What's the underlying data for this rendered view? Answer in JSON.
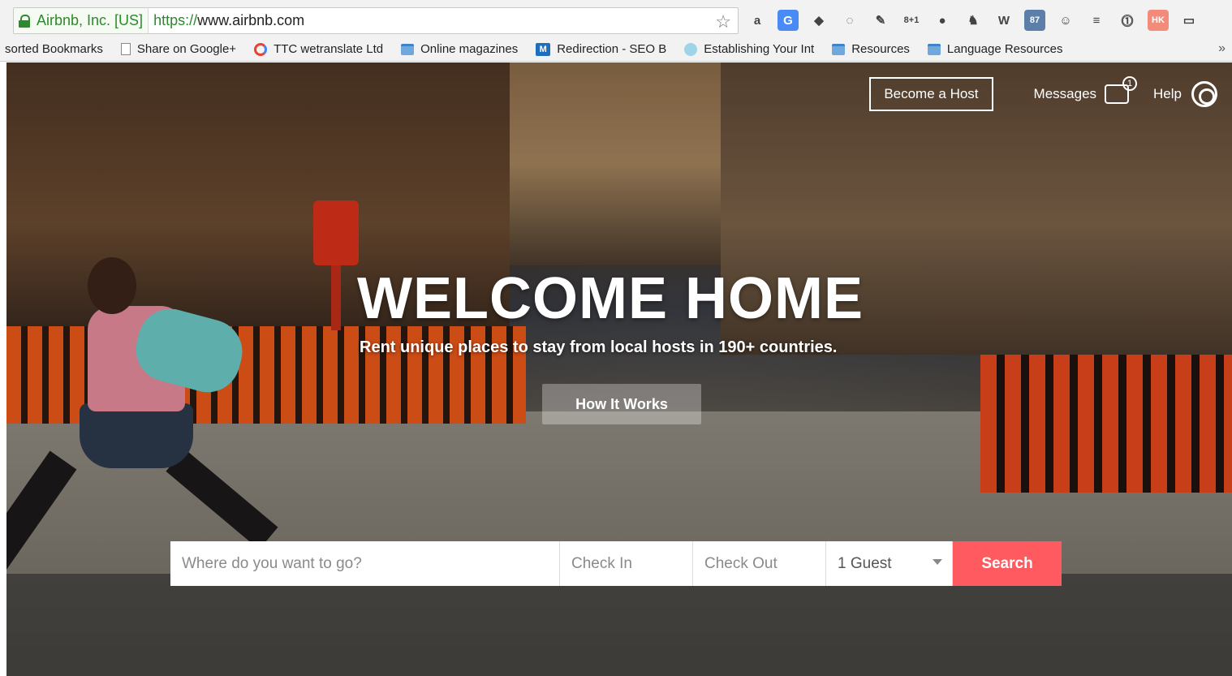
{
  "browser": {
    "ev_label": "Airbnb, Inc. [US]",
    "url_scheme": "https://",
    "url_host": "www.airbnb.com",
    "bookmarks": [
      {
        "label": "sorted Bookmarks"
      },
      {
        "label": "Share on Google+"
      },
      {
        "label": "TTC wetranslate Ltd"
      },
      {
        "label": "Online magazines"
      },
      {
        "label": "Redirection - SEO B"
      },
      {
        "label": "Establishing Your Int"
      },
      {
        "label": "Resources"
      },
      {
        "label": "Language Resources"
      }
    ],
    "bookmark_more": "»"
  },
  "nav": {
    "become_host": "Become a Host",
    "messages": "Messages",
    "messages_count": "1",
    "help": "Help"
  },
  "hero": {
    "headline": "WELCOME HOME",
    "subhead": "Rent unique places to stay from local hosts in 190+ countries.",
    "how_it_works": "How It Works"
  },
  "search": {
    "where_placeholder": "Where do you want to go?",
    "check_in": "Check In",
    "check_out": "Check Out",
    "guests": "1 Guest",
    "button": "Search"
  },
  "colors": {
    "accent": "#ff5a5f",
    "secure_green": "#2b8a2b"
  }
}
